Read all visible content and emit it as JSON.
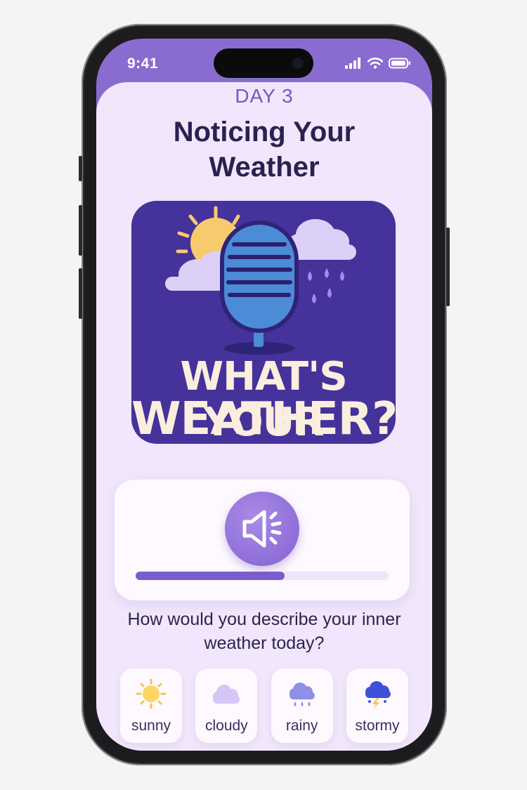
{
  "status_bar": {
    "time": "9:41",
    "icons": [
      "cellular-signal-icon",
      "wifi-icon",
      "battery-icon"
    ]
  },
  "lesson": {
    "day_label": "DAY 3",
    "title": "Noticing Your Weather"
  },
  "cover_art": {
    "line1": "WHAT'S YOUR",
    "line2": "WEATHER?",
    "icons": [
      "sun-icon",
      "cloud-icon",
      "microphone-icon",
      "rain-icon"
    ]
  },
  "player": {
    "button_icon": "speaker-icon",
    "progress": 0.59
  },
  "prompt": {
    "question": "How would you describe your inner weather today?"
  },
  "mood_options": [
    {
      "label": "sunny",
      "icon": "sun-icon"
    },
    {
      "label": "cloudy",
      "icon": "cloud-icon"
    },
    {
      "label": "rainy",
      "icon": "rain-cloud-icon"
    },
    {
      "label": "stormy",
      "icon": "storm-cloud-icon"
    }
  ],
  "colors": {
    "accent": "#7a5ccc",
    "header": "#8a6cd0",
    "background": "#f1e6fb",
    "cover_bg": "#45329a",
    "title_text": "#2a2150"
  }
}
